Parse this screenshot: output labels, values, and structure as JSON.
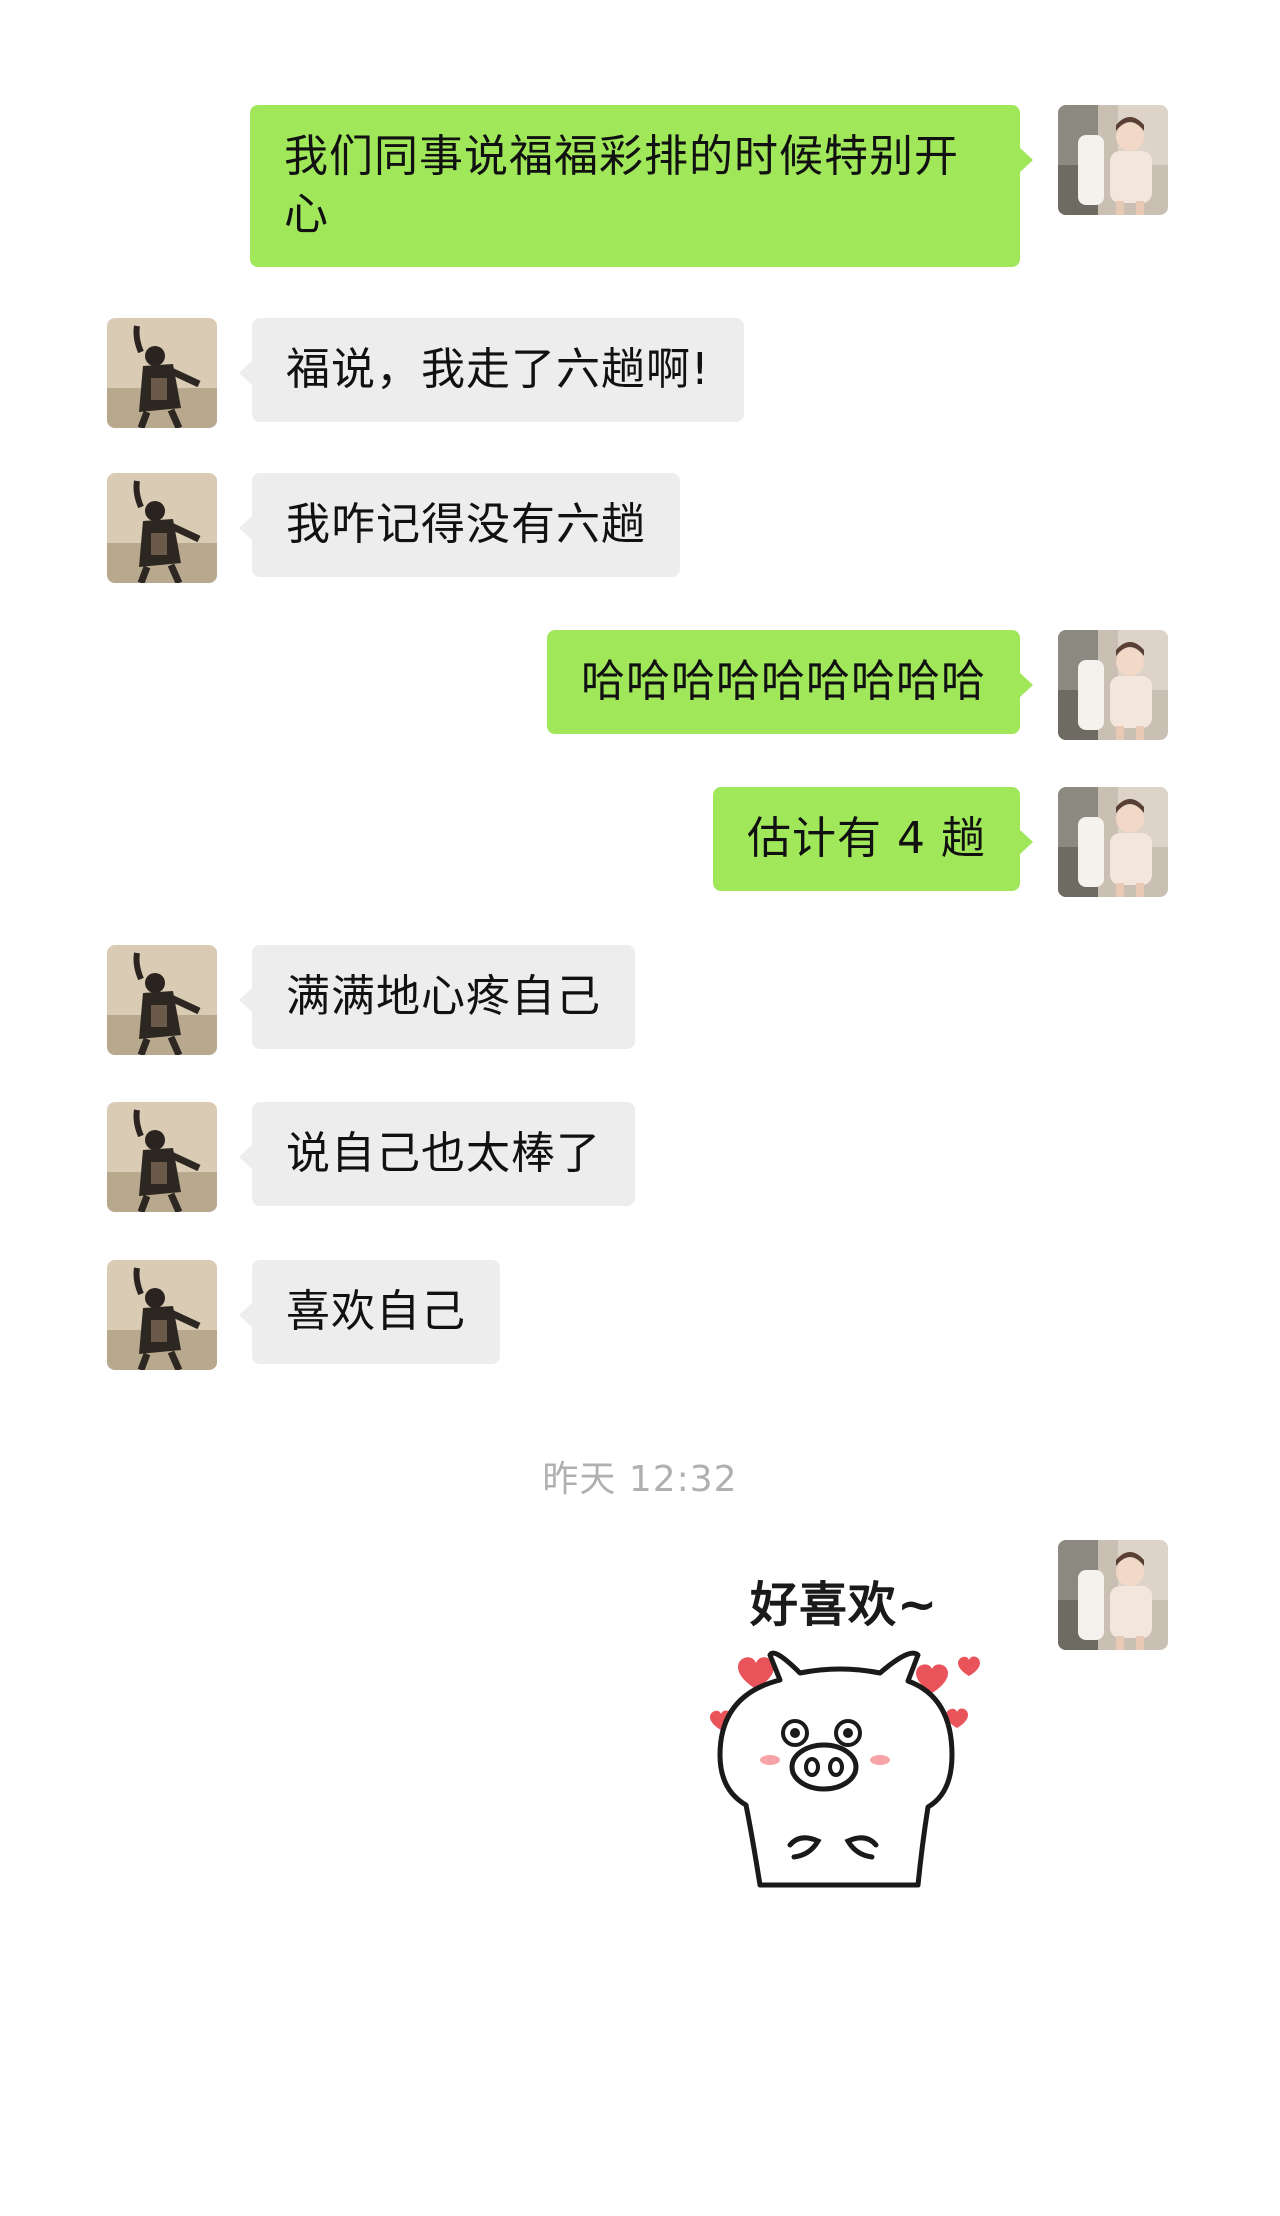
{
  "messages": [
    {
      "side": "out",
      "text": "我们同事说福福彩排的时候特别开心"
    },
    {
      "side": "in",
      "text": "福说，我走了六趟啊!"
    },
    {
      "side": "in",
      "text": "我咋记得没有六趟"
    },
    {
      "side": "out",
      "text": "哈哈哈哈哈哈哈哈哈"
    },
    {
      "side": "out",
      "text": "估计有 4 趟"
    },
    {
      "side": "in",
      "text": "满满地心疼自己"
    },
    {
      "side": "in",
      "text": "说自己也太棒了"
    },
    {
      "side": "in",
      "text": "喜欢自己"
    }
  ],
  "timestamp": "昨天 12:32",
  "sticker": {
    "text": "好喜欢~",
    "icon": "pig-sticker-icon"
  },
  "colors": {
    "outgoing_bubble": "#a0e75a",
    "incoming_bubble": "#ededed",
    "timestamp": "#b0b0b0"
  }
}
